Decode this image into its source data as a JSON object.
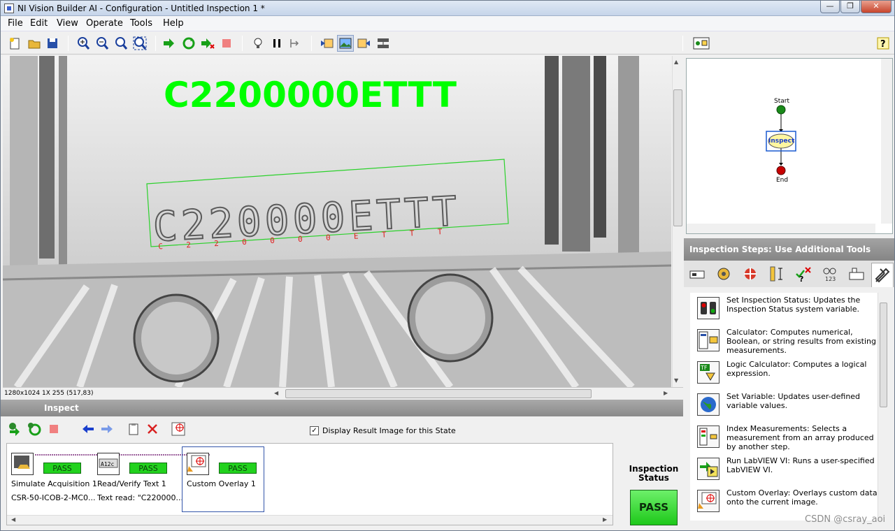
{
  "window": {
    "title": "NI Vision Builder AI - Configuration - Untitled Inspection 1 *"
  },
  "menu": [
    "File",
    "Edit",
    "View",
    "Operate",
    "Tools",
    "Help"
  ],
  "overlay": {
    "big_text": "C2200000ETTT",
    "char_labels": [
      "C",
      "2",
      "2",
      "0",
      "0",
      "0",
      "0",
      "E",
      "T",
      "T",
      "T"
    ]
  },
  "image_info": {
    "text": "1280x1024 1X 255",
    "coords": "(517,83)"
  },
  "state_panel": {
    "title": "Inspect",
    "display_checkbox_label": "Display Result Image for this State",
    "display_checked": true
  },
  "steps": [
    {
      "name": "Simulate Acquisition 1",
      "result": "CSR-50-ICOB-2-MC0...",
      "status": "PASS"
    },
    {
      "name": "Read/Verify Text 1",
      "result": "Text read: \"C220000...",
      "status": "PASS"
    },
    {
      "name": "Custom Overlay 1",
      "result": "",
      "status": "PASS"
    }
  ],
  "flow": {
    "start": "Start",
    "inspect": "Inspect",
    "end": "End"
  },
  "tools_panel": {
    "title": "Inspection Steps: Use Additional Tools",
    "tools": [
      {
        "name": "Set Inspection Status:",
        "desc": "Updates the Inspection Status system variable."
      },
      {
        "name": "Calculator:",
        "desc": "Computes numerical, Boolean, or string results from existing measurements."
      },
      {
        "name": "Logic Calculator:",
        "desc": "Computes a logical expression."
      },
      {
        "name": "Set Variable:",
        "desc": "Updates user-defined variable values."
      },
      {
        "name": "Index Measurements:",
        "desc": "Selects a measurement from an array produced by another step."
      },
      {
        "name": "Run LabVIEW VI:",
        "desc": "Runs a user-specified LabVIEW VI."
      },
      {
        "name": "Custom Overlay:",
        "desc": "Overlays custom data onto the current image."
      }
    ]
  },
  "inspection_status": {
    "label": "Inspection Status",
    "value": "PASS"
  },
  "watermark": "CSDN @csray_aoi",
  "colors": {
    "overlay_green": "#00ff00",
    "pass_green": "#22d21e",
    "panel_gray": "#8a8a8a"
  }
}
